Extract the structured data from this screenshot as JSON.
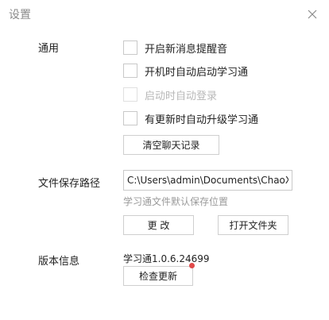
{
  "window": {
    "title": "设置"
  },
  "general": {
    "label": "通用",
    "options": [
      {
        "label": "开启新消息提醒音",
        "checked": false,
        "disabled": false
      },
      {
        "label": "开机时自动启动学习通",
        "checked": false,
        "disabled": false
      },
      {
        "label": "启动时自动登录",
        "checked": false,
        "disabled": true
      },
      {
        "label": "有更新时自动升级学习通",
        "checked": false,
        "disabled": false
      }
    ],
    "clear_button": "清空聊天记录"
  },
  "save_path": {
    "label": "文件保存路径",
    "value": "C:\\Users\\admin\\Documents\\ChaoXi",
    "hint": "学习通文件默认保存位置",
    "change_button": "更 改",
    "open_button": "打开文件夹"
  },
  "version": {
    "label": "版本信息",
    "text": "学习通1.0.6.24699",
    "check_button": "检查更新"
  },
  "colors": {
    "border": "#cfcfcf",
    "hint": "#9a9a9a",
    "update_dot": "#e04a4a"
  },
  "icons": {
    "close": "close-icon"
  }
}
